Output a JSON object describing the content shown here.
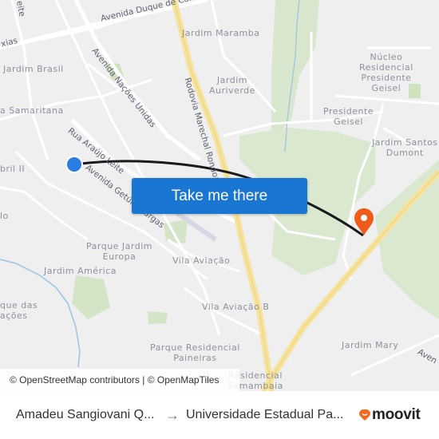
{
  "map": {
    "neighborhoods": [
      {
        "id": "jardim-brasil",
        "text": "Jardim Brasil"
      },
      {
        "id": "samaritana",
        "text": "a Samaritana"
      },
      {
        "id": "abril-ii",
        "text": "bril II"
      },
      {
        "id": "lo",
        "text": "lo"
      },
      {
        "id": "jardim-maramba",
        "text": "Jardim Maramba"
      },
      {
        "id": "jardim-auriverde",
        "text": "Jardim\nAuriverde"
      },
      {
        "id": "nucleo-presidente-geisel",
        "text": "Núcleo\nResidencial\nPresidente\nGeisel"
      },
      {
        "id": "presidente-geisel",
        "text": "Presidente\nGeisel"
      },
      {
        "id": "jardim-santos-dumont",
        "text": "Jardim Santos\nDumont"
      },
      {
        "id": "parque-jardim-europa",
        "text": "Parque Jardim\nEuropa"
      },
      {
        "id": "jardim-america",
        "text": "Jardim América"
      },
      {
        "id": "parque-das-nacoes",
        "text": "que das\nações"
      },
      {
        "id": "vila-aviacao",
        "text": "Vila Aviação"
      },
      {
        "id": "vila-aviacao-b",
        "text": "Vila Aviação B"
      },
      {
        "id": "parque-residencial-paineiras",
        "text": "Parque Residencial\nPaineiras"
      },
      {
        "id": "residencial-samambaia",
        "text": "Residencial\nSamambaia"
      },
      {
        "id": "jardim-mary",
        "text": "Jardim Mary"
      }
    ],
    "roads": [
      {
        "id": "avenida-duque-de-caxias",
        "text": "Avenida Duque de Caxias"
      },
      {
        "id": "caxias-fragment",
        "text": "xias"
      },
      {
        "id": "leite-fragment",
        "text": "eite"
      },
      {
        "id": "avenida-nacoes-unidas",
        "text": "Avenida Nações Unidas"
      },
      {
        "id": "rodovia-marechal-rondon",
        "text": "Rodovia Marechal Rondon"
      },
      {
        "id": "rua-araujo-leite",
        "text": "Rua Araújo Leite"
      },
      {
        "id": "avenida-getulio-vargas",
        "text": "Avenida Getúlio Vargas"
      },
      {
        "id": "avenida-fragment",
        "text": "Aven"
      }
    ],
    "origin_marker_color": "#2a7de1",
    "destination_marker_color": "#f05a1a",
    "route_color": "#1a1a1a"
  },
  "cta": {
    "label": "Take me there",
    "color": "#1976d2"
  },
  "attribution": {
    "osm": "© OpenStreetMap contributors",
    "separator": " | ",
    "omt": "© OpenMapTiles"
  },
  "footer": {
    "origin": "Amadeu Sangiovani Q...",
    "arrow": "→",
    "destination": "Universidade Estadual Pa...",
    "brand": "moovit",
    "brand_color": "#f26b21"
  }
}
